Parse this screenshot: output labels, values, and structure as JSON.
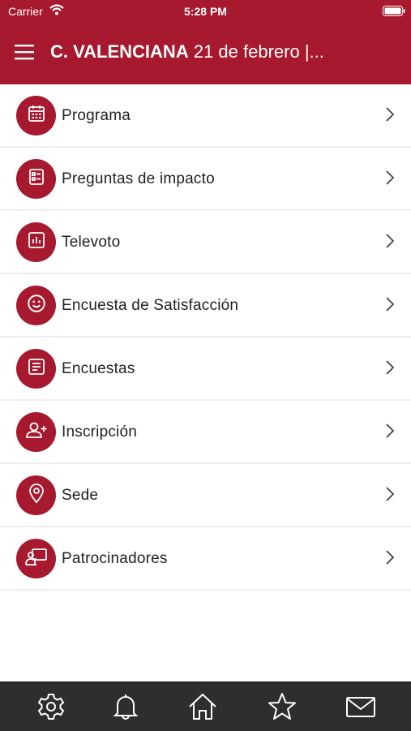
{
  "status_bar": {
    "carrier": "Carrier",
    "time": "5:28 PM"
  },
  "header": {
    "title_bold": "C. VALENCIANA",
    "title_rest": " 21 de febrero |..."
  },
  "menu": {
    "items": [
      {
        "label": "Programa",
        "icon": "calendar-icon"
      },
      {
        "label": "Preguntas de impacto",
        "icon": "list-icon"
      },
      {
        "label": "Televoto",
        "icon": "bar-chart-icon"
      },
      {
        "label": "Encuesta de Satisfacción",
        "icon": "smiley-icon"
      },
      {
        "label": "Encuestas",
        "icon": "form-icon"
      },
      {
        "label": "Inscripción",
        "icon": "add-user-icon"
      },
      {
        "label": "Sede",
        "icon": "location-pin-icon"
      },
      {
        "label": "Patrocinadores",
        "icon": "presentation-icon"
      }
    ]
  },
  "tabbar": {
    "items": [
      "gear-icon",
      "bell-icon",
      "home-icon",
      "star-icon",
      "mail-icon"
    ]
  },
  "colors": {
    "brand": "#a6192e",
    "tabbar": "#2e2e2e"
  }
}
